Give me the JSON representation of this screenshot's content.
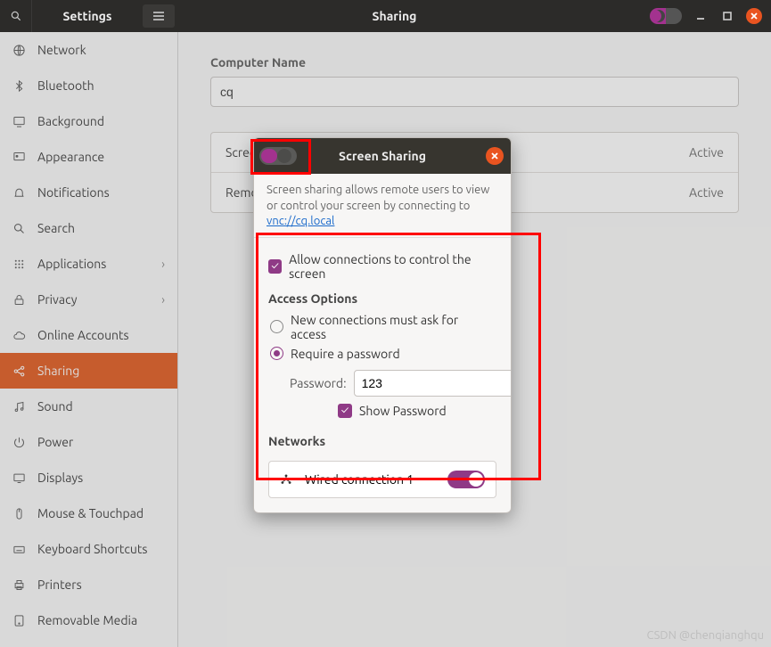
{
  "header": {
    "left_title": "Settings",
    "center_title": "Sharing"
  },
  "sidebar": {
    "items": [
      {
        "icon": "globe",
        "label": "Network"
      },
      {
        "icon": "bluetooth",
        "label": "Bluetooth"
      },
      {
        "icon": "desktop",
        "label": "Background"
      },
      {
        "icon": "brush",
        "label": "Appearance"
      },
      {
        "icon": "bell",
        "label": "Notifications"
      },
      {
        "icon": "search",
        "label": "Search"
      },
      {
        "icon": "grid",
        "label": "Applications",
        "chevron": true
      },
      {
        "icon": "lock",
        "label": "Privacy",
        "chevron": true
      },
      {
        "icon": "cloud",
        "label": "Online Accounts"
      },
      {
        "icon": "share",
        "label": "Sharing",
        "active": true
      },
      {
        "icon": "note",
        "label": "Sound"
      },
      {
        "icon": "power",
        "label": "Power"
      },
      {
        "icon": "displays",
        "label": "Displays"
      },
      {
        "icon": "mouse",
        "label": "Mouse & Touchpad"
      },
      {
        "icon": "keyboard",
        "label": "Keyboard Shortcuts"
      },
      {
        "icon": "printer",
        "label": "Printers"
      },
      {
        "icon": "disk",
        "label": "Removable Media"
      }
    ]
  },
  "content": {
    "computer_name_label": "Computer Name",
    "computer_name_value": "cq",
    "rows": [
      {
        "title": "Screen Sharing",
        "status": "Active"
      },
      {
        "title": "Remote Login",
        "status": "Active"
      }
    ]
  },
  "modal": {
    "title": "Screen Sharing",
    "description_prefix": "Screen sharing allows remote users to view or control your screen by connecting to ",
    "vnc_link": "vnc://cq.local",
    "allow_control_label": "Allow connections to control the screen",
    "allow_control_checked": true,
    "access_options_title": "Access Options",
    "radio_ask_label": "New connections must ask for access",
    "radio_pw_label": "Require a password",
    "radio_selected": "password",
    "password_label": "Password:",
    "password_value": "123",
    "show_password_label": "Show Password",
    "show_password_checked": true,
    "networks_title": "Networks",
    "network_name": "Wired connection 1",
    "network_enabled": true
  },
  "watermark": "CSDN @chenqianghqu"
}
